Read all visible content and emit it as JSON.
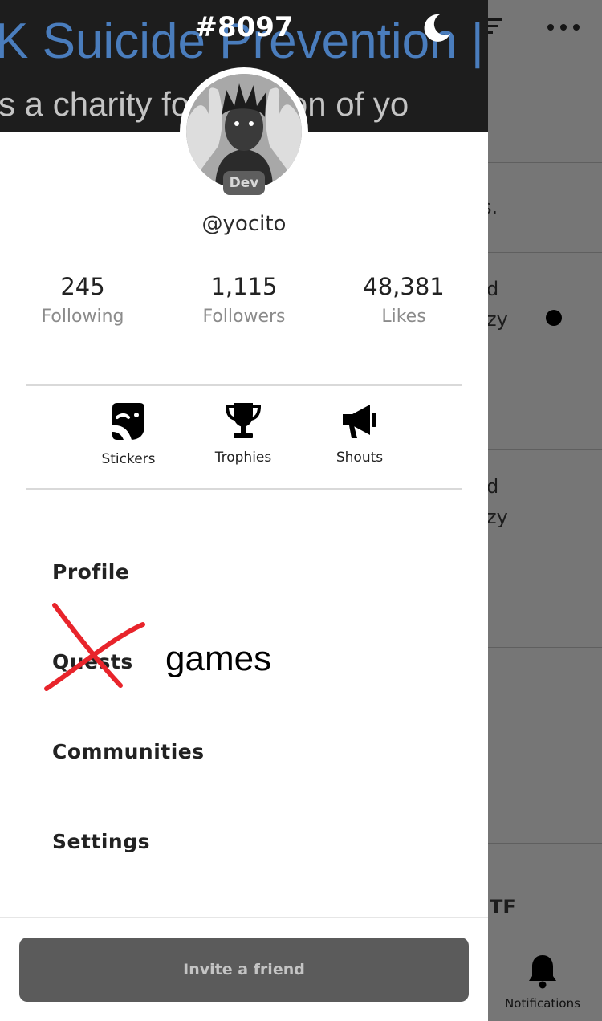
{
  "banner": {
    "line1": "K Suicide Prevention | P",
    "line2": "s a charity fo          evention of yo",
    "tag": "#8097"
  },
  "profile": {
    "badge": "Dev",
    "username": "@yocito"
  },
  "stats": [
    {
      "value": "245",
      "label": "Following"
    },
    {
      "value": "1,115",
      "label": "Followers"
    },
    {
      "value": "48,381",
      "label": "Likes"
    }
  ],
  "features": [
    {
      "label": "Stickers",
      "icon": "sticker-icon"
    },
    {
      "label": "Trophies",
      "icon": "trophy-icon"
    },
    {
      "label": "Shouts",
      "icon": "megaphone-icon"
    }
  ],
  "menu": {
    "profile": "Profile",
    "quests": "Quests",
    "communities": "Communities",
    "settings": "Settings"
  },
  "annotation": {
    "handwritten": "games"
  },
  "invite": {
    "label": "Invite a friend"
  },
  "background": {
    "row1_text": "s.",
    "row2_text_a": "d",
    "row2_text_b": "zy",
    "row3_text_a": "d",
    "row3_text_b": "zy",
    "row5_text": "TF",
    "notifications_label": "Notifications"
  },
  "colors": {
    "banner_link": "#4a7dbd",
    "overlay": "#767676",
    "invite_button": "#5b5b5b",
    "strike_red": "#e8242b"
  }
}
